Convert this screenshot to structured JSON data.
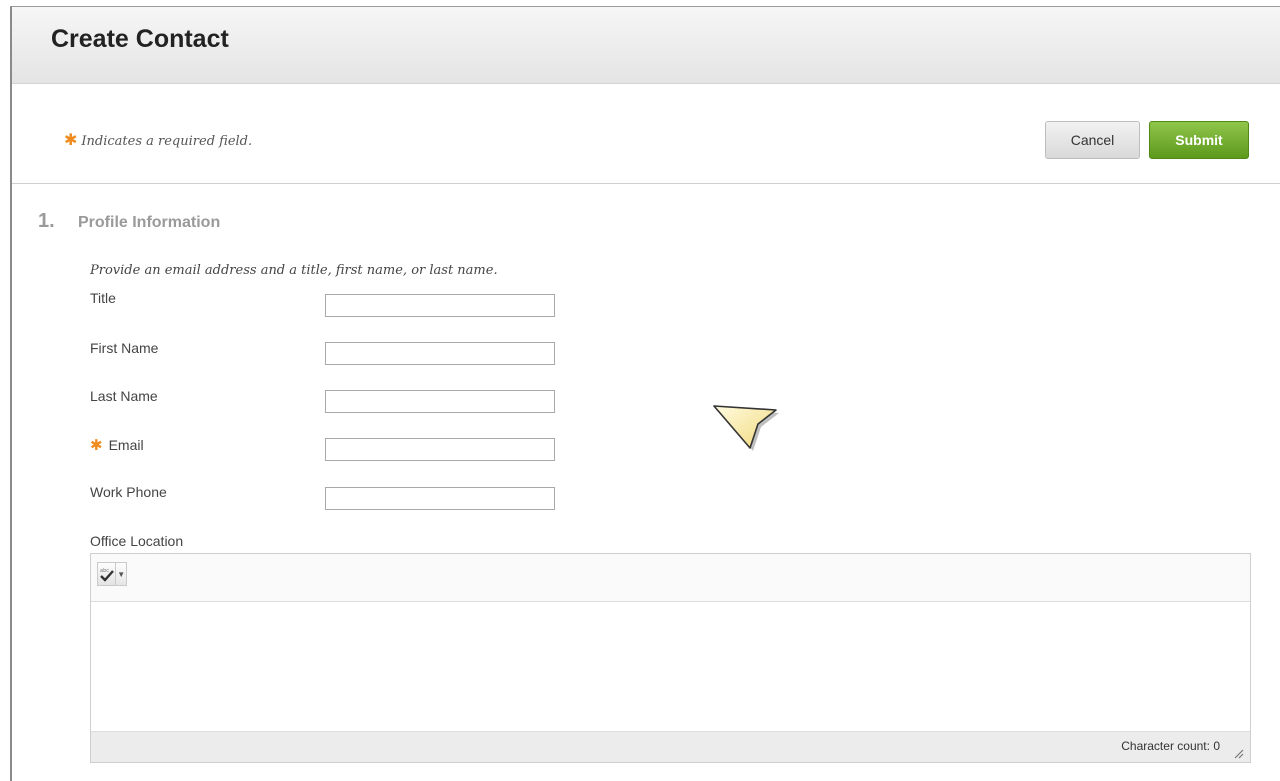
{
  "page": {
    "title": "Create Contact"
  },
  "required_note": "Indicates a required field.",
  "buttons": {
    "cancel": "Cancel",
    "submit": "Submit"
  },
  "step": {
    "number": "1.",
    "title": "Profile Information",
    "instructions": "Provide an email address and a title, first name, or last name."
  },
  "fields": {
    "title": {
      "label": "Title",
      "value": ""
    },
    "first_name": {
      "label": "First Name",
      "value": ""
    },
    "last_name": {
      "label": "Last Name",
      "value": ""
    },
    "email": {
      "label": "Email",
      "value": "",
      "required": true
    },
    "work_phone": {
      "label": "Work Phone",
      "value": ""
    }
  },
  "office_location": {
    "label": "Office Location",
    "toolbar": {
      "spellcheck_icon": "spellcheck-icon",
      "dropdown_icon": "chevron-down-icon"
    },
    "char_count_label": "Character count:",
    "char_count_value": "0"
  },
  "colors": {
    "required_star": "#f08c1e",
    "submit_green": "#6aab27",
    "header_gray": "#e8e8e8"
  }
}
